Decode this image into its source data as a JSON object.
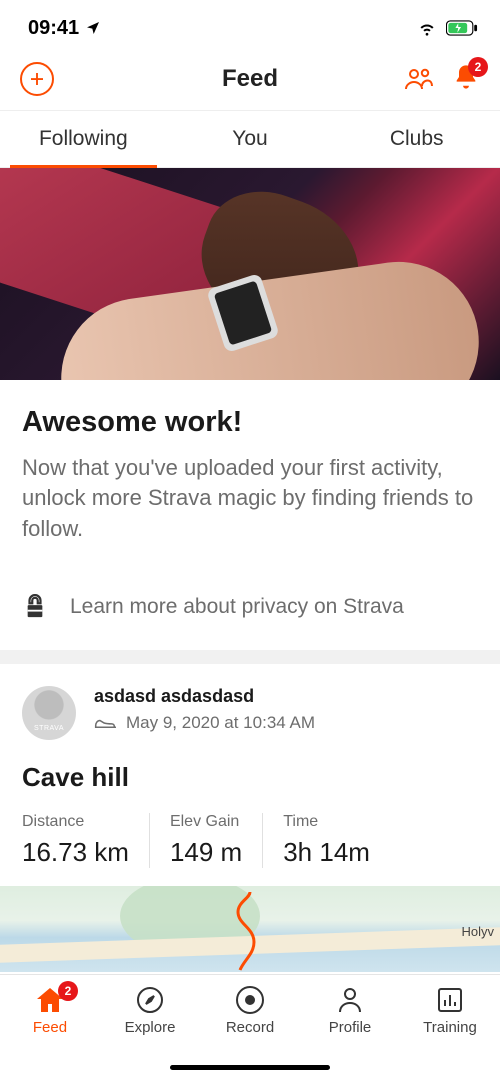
{
  "status": {
    "time": "09:41"
  },
  "header": {
    "title": "Feed",
    "notification_count": "2"
  },
  "tabs": {
    "following": "Following",
    "you": "You",
    "clubs": "Clubs"
  },
  "promo": {
    "title": "Awesome work!",
    "body": "Now that you've uploaded your first activity, unlock more Strava magic by finding friends to follow.",
    "privacy": "Learn more about privacy on Strava"
  },
  "activity": {
    "avatar_brand": "STRAVA",
    "user": "asdasd asdasdasd",
    "date": "May 9, 2020 at 10:34 AM",
    "title": "Cave hill",
    "stats": {
      "distance_label": "Distance",
      "distance_value": "16.73 km",
      "elev_label": "Elev Gain",
      "elev_value": "149 m",
      "time_label": "Time",
      "time_value": "3h 14m"
    },
    "map_place": "Holyv"
  },
  "tabbar": {
    "feed": "Feed",
    "feed_badge": "2",
    "explore": "Explore",
    "record": "Record",
    "profile": "Profile",
    "training": "Training"
  }
}
